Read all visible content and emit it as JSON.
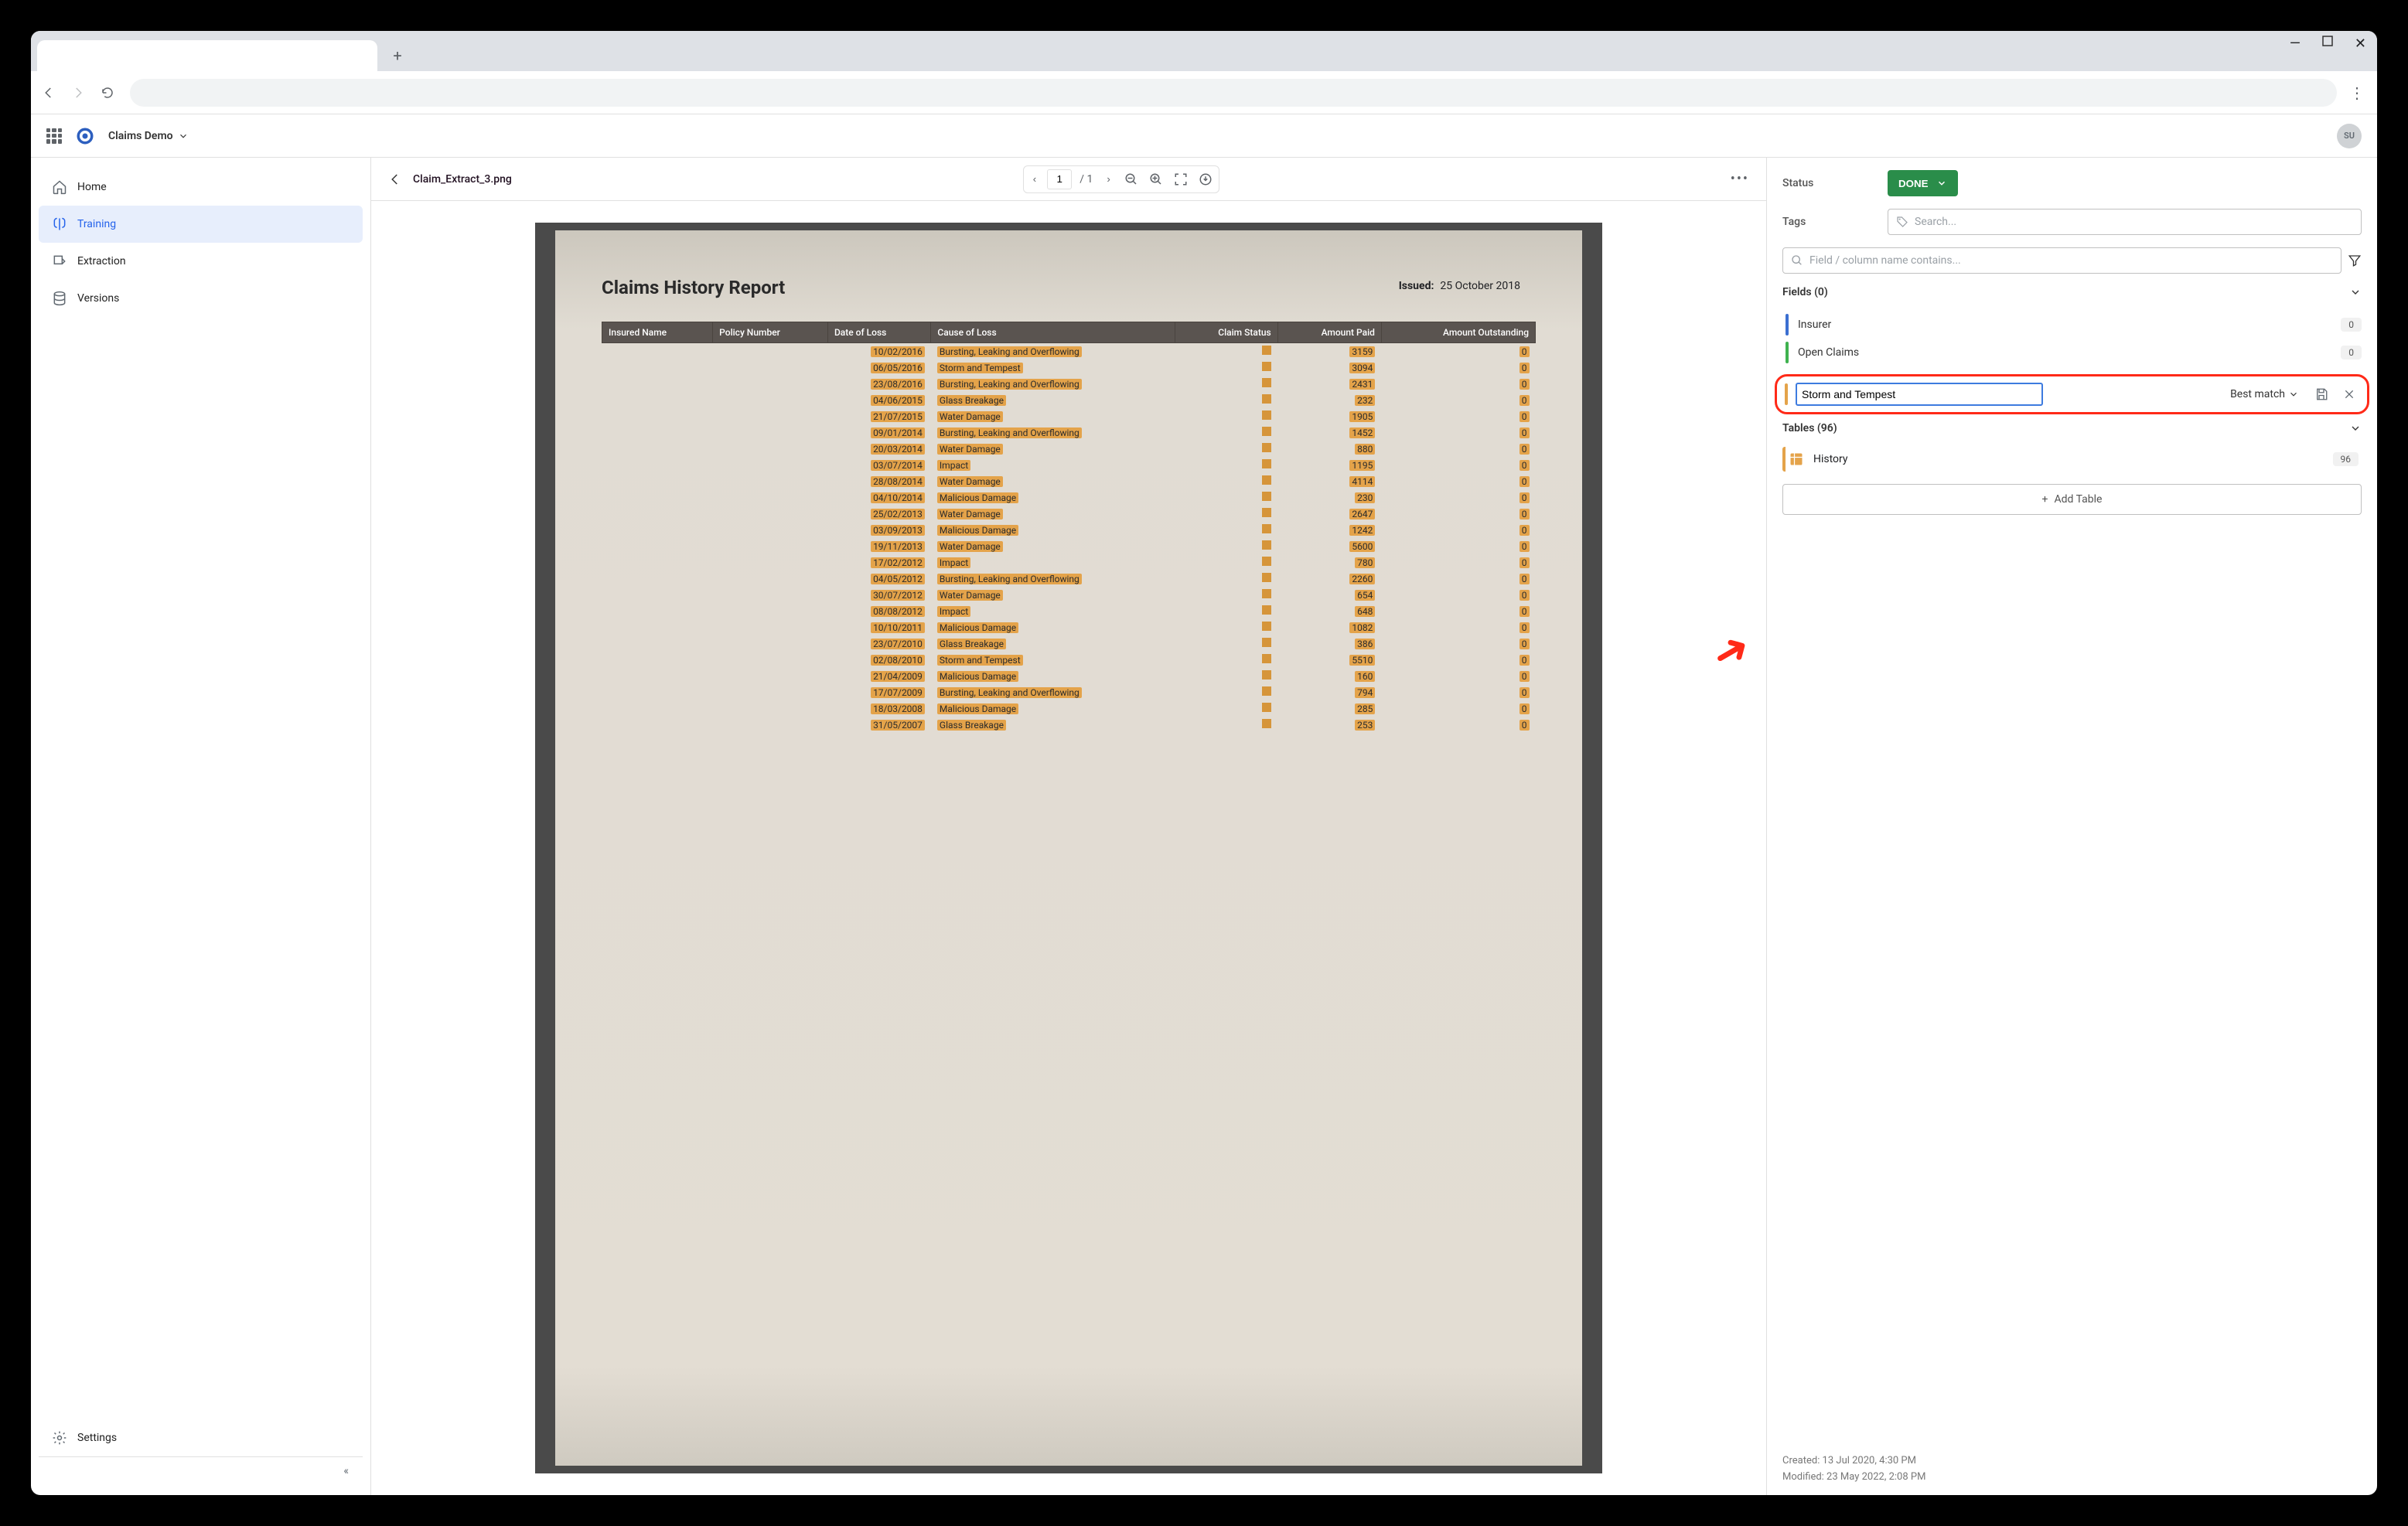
{
  "window": {
    "min": "—",
    "max": "▢",
    "close": "✕"
  },
  "browser": {
    "tab_title": "",
    "newtab": "+",
    "back": "←",
    "forward": "→",
    "reload": "⟳",
    "menu": "⋮"
  },
  "app": {
    "crumb": "Claims Demo",
    "avatar": "SU"
  },
  "sidebar": {
    "items": [
      {
        "label": "Home"
      },
      {
        "label": "Training"
      },
      {
        "label": "Extraction"
      },
      {
        "label": "Versions"
      }
    ],
    "settings": "Settings",
    "collapse": "«"
  },
  "doc": {
    "filename": "Claim_Extract_3.png",
    "page_current": "1",
    "page_total": "1",
    "title": "Claims History Report",
    "issued_label": "Issued:",
    "issued_value": "25 October 2018",
    "columns": [
      "Insured Name",
      "Policy Number",
      "Date of Loss",
      "Cause of Loss",
      "Claim Status",
      "Amount Paid",
      "Amount Outstanding"
    ],
    "rows": [
      {
        "date": "10/02/2016",
        "cause": "Bursting, Leaking and Overflowing",
        "status": "C",
        "paid": "3159",
        "out": "0"
      },
      {
        "date": "06/05/2016",
        "cause": "Storm and Tempest",
        "status": "C",
        "paid": "3094",
        "out": "0"
      },
      {
        "date": "23/08/2016",
        "cause": "Bursting, Leaking and Overflowing",
        "status": "C",
        "paid": "2431",
        "out": "0"
      },
      {
        "date": "04/06/2015",
        "cause": "Glass Breakage",
        "status": "C",
        "paid": "232",
        "out": "0"
      },
      {
        "date": "21/07/2015",
        "cause": "Water Damage",
        "status": "C",
        "paid": "1905",
        "out": "0"
      },
      {
        "date": "09/01/2014",
        "cause": "Bursting, Leaking and Overflowing",
        "status": "C",
        "paid": "1452",
        "out": "0"
      },
      {
        "date": "20/03/2014",
        "cause": "Water Damage",
        "status": "C",
        "paid": "880",
        "out": "0"
      },
      {
        "date": "03/07/2014",
        "cause": "Impact",
        "status": "C",
        "paid": "1195",
        "out": "0"
      },
      {
        "date": "28/08/2014",
        "cause": "Water Damage",
        "status": "C",
        "paid": "4114",
        "out": "0"
      },
      {
        "date": "04/10/2014",
        "cause": "Malicious Damage",
        "status": "C",
        "paid": "230",
        "out": "0"
      },
      {
        "date": "25/02/2013",
        "cause": "Water Damage",
        "status": "C",
        "paid": "2647",
        "out": "0"
      },
      {
        "date": "03/09/2013",
        "cause": "Malicious Damage",
        "status": "C",
        "paid": "1242",
        "out": "0"
      },
      {
        "date": "19/11/2013",
        "cause": "Water Damage",
        "status": "C",
        "paid": "5600",
        "out": "0"
      },
      {
        "date": "17/02/2012",
        "cause": "Impact",
        "status": "C",
        "paid": "780",
        "out": "0"
      },
      {
        "date": "04/05/2012",
        "cause": "Bursting, Leaking and Overflowing",
        "status": "C",
        "paid": "2260",
        "out": "0"
      },
      {
        "date": "30/07/2012",
        "cause": "Water Damage",
        "status": "C",
        "paid": "654",
        "out": "0"
      },
      {
        "date": "08/08/2012",
        "cause": "Impact",
        "status": "C",
        "paid": "648",
        "out": "0"
      },
      {
        "date": "10/10/2011",
        "cause": "Malicious Damage",
        "status": "C",
        "paid": "1082",
        "out": "0"
      },
      {
        "date": "23/07/2010",
        "cause": "Glass Breakage",
        "status": "C",
        "paid": "386",
        "out": "0"
      },
      {
        "date": "02/08/2010",
        "cause": "Storm and Tempest",
        "status": "C",
        "paid": "5510",
        "out": "0"
      },
      {
        "date": "21/04/2009",
        "cause": "Malicious Damage",
        "status": "C",
        "paid": "160",
        "out": "0"
      },
      {
        "date": "17/07/2009",
        "cause": "Bursting, Leaking and Overflowing",
        "status": "C",
        "paid": "794",
        "out": "0"
      },
      {
        "date": "18/03/2008",
        "cause": "Malicious Damage",
        "status": "C",
        "paid": "285",
        "out": "0"
      },
      {
        "date": "31/05/2007",
        "cause": "Glass Breakage",
        "status": "C",
        "paid": "253",
        "out": "0"
      }
    ]
  },
  "panel": {
    "status_label": "Status",
    "status_value": "DONE",
    "tags_label": "Tags",
    "tags_placeholder": "Search...",
    "filter_placeholder": "Field / column name contains...",
    "fields_header": "Fields (0)",
    "fields": [
      {
        "name": "Insurer",
        "count": "0",
        "color": "#3b6fd1"
      },
      {
        "name": "Open Claims",
        "count": "0",
        "color": "#3fb24f"
      }
    ],
    "new_field_value": "Storm and Tempest",
    "best_match": "Best match",
    "tables_header": "Tables (96)",
    "table_name": "History",
    "table_count": "96",
    "add_table": "Add Table",
    "created": "Created: 13 Jul 2020, 4:30 PM",
    "modified": "Modified: 23 May 2022, 2:08 PM"
  }
}
